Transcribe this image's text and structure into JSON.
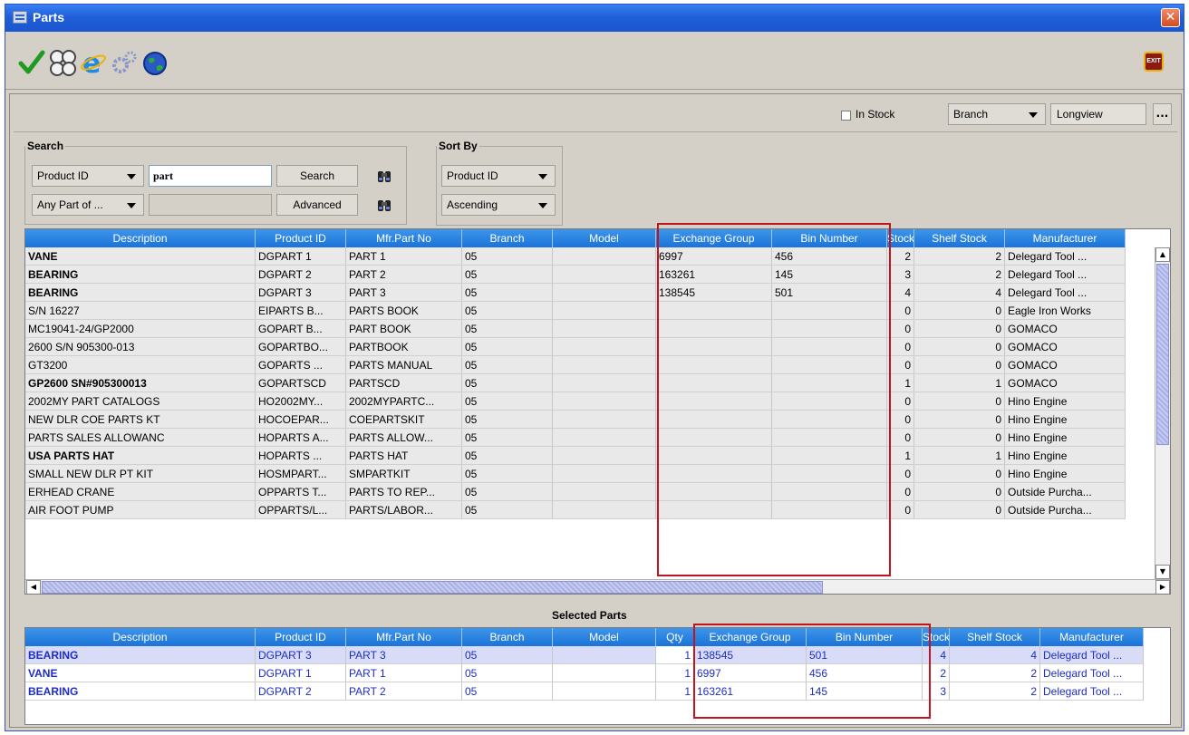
{
  "window": {
    "title": "Parts",
    "close_label": "✕"
  },
  "toolbar": {
    "icons": [
      "check-icon",
      "calculator-icon",
      "ie-icon",
      "gears-icon",
      "globe-icon"
    ],
    "exit_label": "EXIT"
  },
  "filter": {
    "in_stock_label": "In Stock",
    "branch_select": "Branch",
    "location_value": "Longview",
    "browse_label": "..."
  },
  "search": {
    "legend": "Search",
    "field_select": "Product ID",
    "query_value": "part",
    "match_select": "Any Part of ...",
    "search_button": "Search",
    "advanced_button": "Advanced"
  },
  "sort": {
    "legend": "Sort By",
    "field_select": "Product ID",
    "order_select": "Ascending"
  },
  "parts_grid": {
    "columns": [
      "Description",
      "Product ID",
      "Mfr.Part No",
      "Branch",
      "Model",
      "Exchange Group",
      "Bin Number",
      "Stock",
      "Shelf Stock",
      "Manufacturer"
    ],
    "rows": [
      {
        "bold": true,
        "cells": [
          "VANE",
          "DGPART 1",
          "PART 1",
          "05",
          "",
          "6997",
          "456",
          "2",
          "2",
          "Delegard Tool ..."
        ]
      },
      {
        "bold": true,
        "cells": [
          "BEARING",
          "DGPART 2",
          "PART 2",
          "05",
          "",
          "163261",
          "145",
          "3",
          "2",
          "Delegard Tool ..."
        ]
      },
      {
        "bold": true,
        "cells": [
          "BEARING",
          "DGPART 3",
          "PART 3",
          "05",
          "",
          "138545",
          "501",
          "4",
          "4",
          "Delegard Tool ..."
        ]
      },
      {
        "bold": false,
        "cells": [
          "S/N 16227",
          "EIPARTS B...",
          "PARTS BOOK",
          "05",
          "",
          "",
          "",
          "0",
          "0",
          "Eagle Iron Works"
        ]
      },
      {
        "bold": false,
        "cells": [
          "MC19041-24/GP2000",
          "GOPART B...",
          "PART BOOK",
          "05",
          "",
          "",
          "",
          "0",
          "0",
          "GOMACO"
        ]
      },
      {
        "bold": false,
        "cells": [
          "2600 S/N 905300-013",
          "GOPARTBO...",
          "PARTBOOK",
          "05",
          "",
          "",
          "",
          "0",
          "0",
          "GOMACO"
        ]
      },
      {
        "bold": false,
        "cells": [
          "GT3200",
          "GOPARTS ...",
          "PARTS MANUAL",
          "05",
          "",
          "",
          "",
          "0",
          "0",
          "GOMACO"
        ]
      },
      {
        "bold": true,
        "cells": [
          "GP2600 SN#905300013",
          "GOPARTSCD",
          "PARTSCD",
          "05",
          "",
          "",
          "",
          "1",
          "1",
          "GOMACO"
        ]
      },
      {
        "bold": false,
        "cells": [
          "2002MY PART CATALOGS",
          "HO2002MY...",
          "2002MYPARTC...",
          "05",
          "",
          "",
          "",
          "0",
          "0",
          "Hino Engine"
        ]
      },
      {
        "bold": false,
        "cells": [
          "NEW DLR COE PARTS KT",
          "HOCOEPAR...",
          "COEPARTSKIT",
          "05",
          "",
          "",
          "",
          "0",
          "0",
          "Hino Engine"
        ]
      },
      {
        "bold": false,
        "cells": [
          "PARTS SALES ALLOWANC",
          "HOPARTS A...",
          "PARTS ALLOW...",
          "05",
          "",
          "",
          "",
          "0",
          "0",
          "Hino Engine"
        ]
      },
      {
        "bold": true,
        "cells": [
          "USA PARTS HAT",
          "HOPARTS ...",
          "PARTS HAT",
          "05",
          "",
          "",
          "",
          "1",
          "1",
          "Hino Engine"
        ]
      },
      {
        "bold": false,
        "cells": [
          "SMALL NEW DLR PT KIT",
          "HOSMPART...",
          "SMPARTKIT",
          "05",
          "",
          "",
          "",
          "0",
          "0",
          "Hino Engine"
        ]
      },
      {
        "bold": false,
        "cells": [
          "ERHEAD CRANE",
          "OPPARTS T...",
          "PARTS TO REP...",
          "05",
          "",
          "",
          "",
          "0",
          "0",
          "Outside Purcha..."
        ]
      },
      {
        "bold": false,
        "cells": [
          "AIR FOOT PUMP",
          "OPPARTS/L...",
          "PARTS/LABOR...",
          "05",
          "",
          "",
          "",
          "0",
          "0",
          "Outside Purcha..."
        ]
      }
    ]
  },
  "selected": {
    "title": "Selected Parts",
    "columns": [
      "Description",
      "Product ID",
      "Mfr.Part No",
      "Branch",
      "Model",
      "Qty",
      "Exchange Group",
      "Bin Number",
      "Stock",
      "Shelf Stock",
      "Manufacturer"
    ],
    "rows": [
      {
        "cells": [
          "BEARING",
          "DGPART 3",
          "PART 3",
          "05",
          "",
          "1",
          "138545",
          "501",
          "4",
          "4",
          "Delegard Tool ..."
        ]
      },
      {
        "cells": [
          "VANE",
          "DGPART 1",
          "PART 1",
          "05",
          "",
          "1",
          "6997",
          "456",
          "2",
          "2",
          "Delegard Tool ..."
        ]
      },
      {
        "cells": [
          "BEARING",
          "DGPART 2",
          "PART 2",
          "05",
          "",
          "1",
          "163261",
          "145",
          "3",
          "2",
          "Delegard Tool ..."
        ]
      }
    ]
  },
  "colors": {
    "header_blue": "#1b73d8",
    "highlight_red": "#c0141f",
    "selected_text": "#1c2cc8"
  }
}
